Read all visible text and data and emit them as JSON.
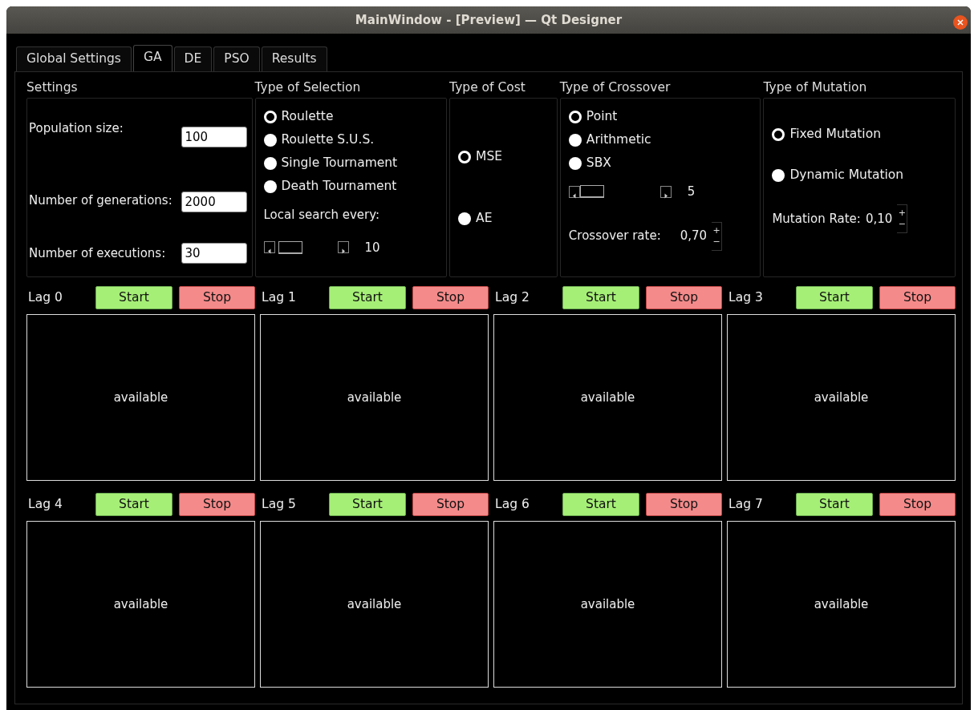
{
  "window": {
    "title": "MainWindow - [Preview] — Qt Designer"
  },
  "tabs": [
    {
      "label": "Global Settings",
      "selected": false
    },
    {
      "label": "GA",
      "selected": true
    },
    {
      "label": "DE",
      "selected": false
    },
    {
      "label": "PSO",
      "selected": false
    },
    {
      "label": "Results",
      "selected": false
    }
  ],
  "settings": {
    "title": "Settings",
    "fields": [
      {
        "label": "Population size:",
        "value": "100"
      },
      {
        "label": "Number of generations:",
        "value": "2000"
      },
      {
        "label": "Number of executions:",
        "value": "30"
      }
    ]
  },
  "selection": {
    "title": "Type of Selection",
    "options": [
      {
        "label": "Roulette",
        "selected": true
      },
      {
        "label": "Roulette S.U.S.",
        "selected": false
      },
      {
        "label": "Single Tournament",
        "selected": false
      },
      {
        "label": "Death Tournament",
        "selected": false
      }
    ],
    "local_search_label": "Local search every:",
    "slider": {
      "reading": "10"
    }
  },
  "cost": {
    "title": "Type of Cost",
    "options": [
      {
        "label": "MSE",
        "selected": true
      },
      {
        "label": "AE",
        "selected": false
      }
    ]
  },
  "crossover": {
    "title": "Type of Crossover",
    "options": [
      {
        "label": "Point",
        "selected": true
      },
      {
        "label": "Arithmetic",
        "selected": false
      },
      {
        "label": "SBX",
        "selected": false
      }
    ],
    "slider": {
      "reading": "5"
    },
    "rate": {
      "label": "Crossover rate:",
      "value": "0,70",
      "up": "+",
      "down": "−"
    }
  },
  "mutation": {
    "title": "Type of Mutation",
    "options": [
      {
        "label": "Fixed Mutation",
        "selected": true
      },
      {
        "label": "Dynamic Mutation",
        "selected": false
      }
    ],
    "rate": {
      "label": "Mutation Rate:",
      "value": "0,10",
      "up": "+",
      "down": "−"
    }
  },
  "lags": [
    {
      "label": "Lag 0",
      "start": "Start",
      "stop": "Stop",
      "status": "available"
    },
    {
      "label": "Lag 1",
      "start": "Start",
      "stop": "Stop",
      "status": "available"
    },
    {
      "label": "Lag 2",
      "start": "Start",
      "stop": "Stop",
      "status": "available"
    },
    {
      "label": "Lag 3",
      "start": "Start",
      "stop": "Stop",
      "status": "available"
    },
    {
      "label": "Lag 4",
      "start": "Start",
      "stop": "Stop",
      "status": "available"
    },
    {
      "label": "Lag 5",
      "start": "Start",
      "stop": "Stop",
      "status": "available"
    },
    {
      "label": "Lag 6",
      "start": "Start",
      "stop": "Stop",
      "status": "available"
    },
    {
      "label": "Lag 7",
      "start": "Start",
      "stop": "Stop",
      "status": "available"
    }
  ]
}
